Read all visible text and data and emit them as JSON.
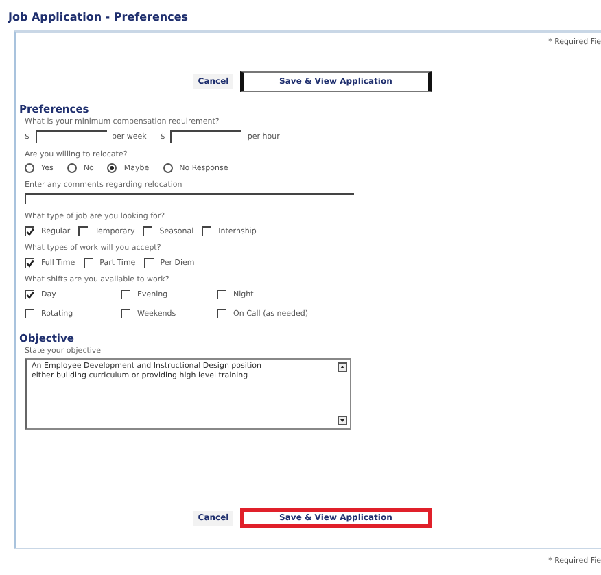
{
  "title": "Job Application - Preferences",
  "required_note_top": "* Required Fie",
  "top_buttons": {
    "cancel": "Cancel",
    "save": "Save & View Application",
    "highlighted": false
  },
  "preferences": {
    "heading": "Preferences",
    "compensation": {
      "question": "What is your minimum compensation requirement?",
      "fields": [
        {
          "currency": "$",
          "unit": "per week"
        },
        {
          "currency": "$",
          "unit": "per hour"
        }
      ]
    },
    "relocate": {
      "question": "Are you willing to relocate?",
      "options": [
        {
          "label": "Yes",
          "selected": false
        },
        {
          "label": "No",
          "selected": false
        },
        {
          "label": "Maybe",
          "selected": true
        },
        {
          "label": "No Response",
          "selected": false
        }
      ]
    },
    "relocation_comments": {
      "label": "Enter any comments regarding relocation"
    },
    "groups": [
      {
        "question": "What type of job are you looking for?",
        "options": [
          {
            "label": "Regular",
            "checked": true
          },
          {
            "label": "Temporary",
            "checked": false
          },
          {
            "label": "Seasonal",
            "checked": false
          },
          {
            "label": "Internship",
            "checked": false
          }
        ]
      },
      {
        "question": "What types of work will you accept?",
        "options": [
          {
            "label": "Full Time",
            "checked": true
          },
          {
            "label": "Part Time",
            "checked": false
          },
          {
            "label": "Per Diem",
            "checked": false
          }
        ]
      },
      {
        "question": "What shifts are you available to work?",
        "options": [
          {
            "label": "Day",
            "checked": true
          },
          {
            "label": "Evening",
            "checked": false
          },
          {
            "label": "Night",
            "checked": false
          },
          {
            "label": "Rotating",
            "checked": false
          },
          {
            "label": "Weekends",
            "checked": false
          },
          {
            "label": "On Call (as needed)",
            "checked": false
          }
        ]
      }
    ]
  },
  "objective": {
    "heading": "Objective",
    "label": "State your objective",
    "value": "An Employee Development and Instructional Design position either building curriculum or providing high level training"
  },
  "bottom_buttons": {
    "cancel": "Cancel",
    "save": "Save & View Application",
    "highlighted": true
  },
  "required_note_bottom": "* Required Fie"
}
